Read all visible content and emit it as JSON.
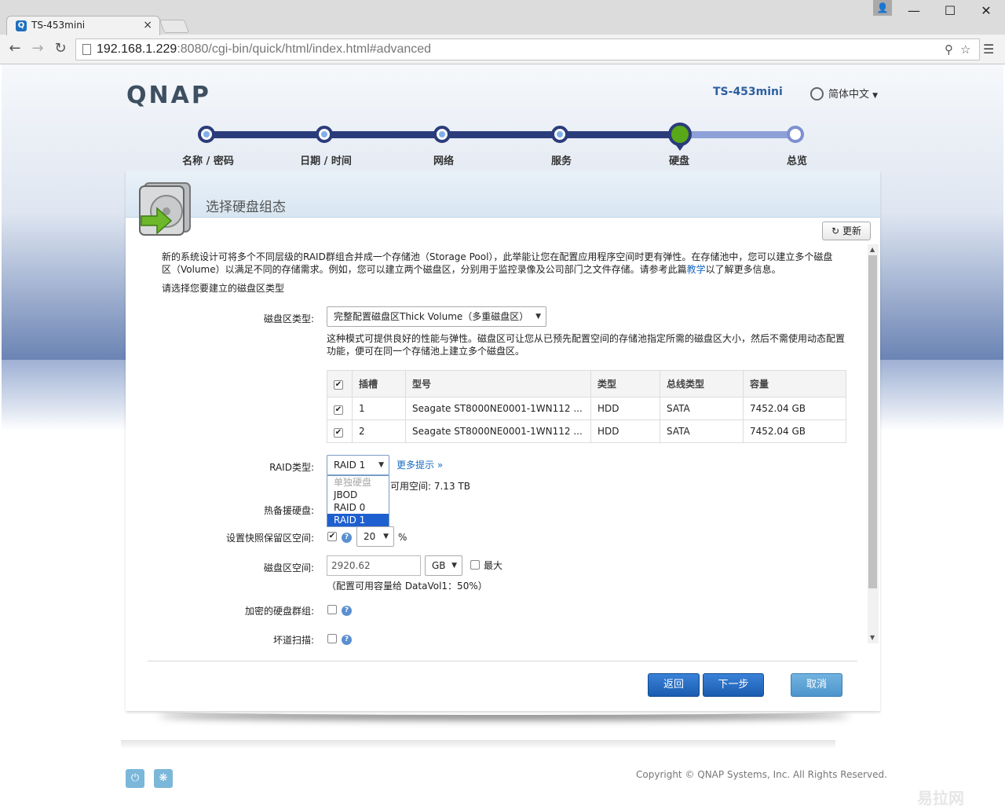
{
  "browser": {
    "tab_title": "TS-453mini",
    "tab_favicon": "Q",
    "close_tab": "×",
    "url_host": "192.168.1.229",
    "url_rest": ":8080/cgi-bin/quick/html/index.html#advanced"
  },
  "header": {
    "logo": "QNAP",
    "model": "TS-453mini",
    "language": "简体中文"
  },
  "steps": [
    "名称 / 密码",
    "日期 / 时间",
    "网络",
    "服务",
    "硬盘",
    "总览"
  ],
  "active_step": 4,
  "dialog": {
    "title": "选择硬盘组态",
    "refresh_label": "更新",
    "intro_line1": "新的系统设计可将多个不同层级的RAID群组合并成一个存储池（Storage Pool），此举能让您在配置应用程序空间时更有弹性。在存储池中，您可以建立多个磁盘",
    "intro_line2a": "区（Volume）以满足不同的存储需求。例如，您可以建立两个磁盘区，分别用于监控录像及公司部门之文件存储。请参考此篇",
    "intro_link": "教学",
    "intro_line2b": "以了解更多信息。",
    "choose_prompt": "请选择您要建立的磁盘区类型",
    "volume_type_label": "磁盘区类型:",
    "volume_type_value": "完整配置磁盘区Thick Volume（多重磁盘区）",
    "volume_desc_line1": "这种模式可提供良好的性能与弹性。磁盘区可让您从已预先配置空间的存储池指定所需的磁盘区大小，然后不需使用动态配置",
    "volume_desc_line2": "功能，便可在同一个存储池上建立多个磁盘区。",
    "table": {
      "headers": [
        "插槽",
        "型号",
        "类型",
        "总线类型",
        "容量"
      ],
      "rows": [
        {
          "slot": "1",
          "model": "Seagate ST8000NE0001-1WN112 ...",
          "type": "HDD",
          "bus": "SATA",
          "capacity": "7452.04 GB"
        },
        {
          "slot": "2",
          "model": "Seagate ST8000NE0001-1WN112 ...",
          "type": "HDD",
          "bus": "SATA",
          "capacity": "7452.04 GB"
        }
      ]
    },
    "raid_label": "RAID类型:",
    "raid_value": "RAID 1",
    "more_tips": "更多提示 »",
    "raid_options": [
      "单独硬盘",
      "JBOD",
      "RAID 0",
      "RAID 1"
    ],
    "available_space": "可用空间:  7.13 TB",
    "hot_spare_label": "热备援硬盘:",
    "snapshot_label": "设置快照保留区空间:",
    "snapshot_value": "20",
    "snapshot_unit": "%",
    "volume_space_label": "磁盘区空间:",
    "volume_space_value": "2920.62",
    "volume_space_unit": "GB",
    "max_label": "最大",
    "allocation_note": "（配置可用容量给 DataVol1：50%）",
    "encrypt_label": "加密的硬盘群组:",
    "bad_block_label": "坏道扫描:",
    "back_label": "返回",
    "next_label": "下一步",
    "cancel_label": "取消"
  },
  "footer": {
    "copyright": "Copyright © QNAP Systems, Inc. All Rights Reserved.",
    "watermark": "易拉网"
  },
  "colors": {
    "step_active": "#58a818",
    "step_line": "#2a3c7a",
    "primary_button": "#1a5cb0",
    "cancel_button": "#4c95cc",
    "link": "#1a6cc0"
  }
}
